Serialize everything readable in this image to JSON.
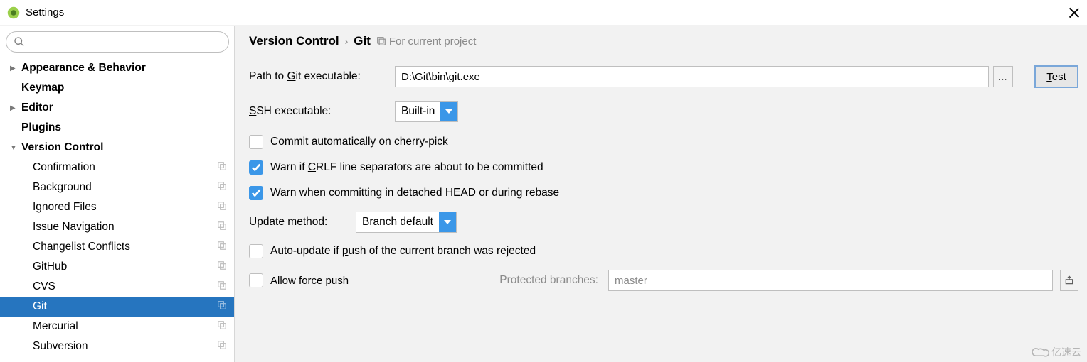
{
  "window": {
    "title": "Settings"
  },
  "sidebar": {
    "search_placeholder": "",
    "items": [
      {
        "label": "Appearance & Behavior",
        "bold": true,
        "caret": "right",
        "level": 1
      },
      {
        "label": "Keymap",
        "bold": true,
        "caret": "",
        "level": 1
      },
      {
        "label": "Editor",
        "bold": true,
        "caret": "right",
        "level": 1
      },
      {
        "label": "Plugins",
        "bold": true,
        "caret": "",
        "level": 1
      },
      {
        "label": "Version Control",
        "bold": true,
        "caret": "down",
        "level": 1
      },
      {
        "label": "Confirmation",
        "level": 2,
        "copy": true
      },
      {
        "label": "Background",
        "level": 2,
        "copy": true
      },
      {
        "label": "Ignored Files",
        "level": 2,
        "copy": true
      },
      {
        "label": "Issue Navigation",
        "level": 2,
        "copy": true
      },
      {
        "label": "Changelist Conflicts",
        "level": 2,
        "copy": true
      },
      {
        "label": "GitHub",
        "level": 2,
        "copy": true
      },
      {
        "label": "CVS",
        "level": 2,
        "copy": true
      },
      {
        "label": "Git",
        "level": 2,
        "copy": true,
        "selected": true
      },
      {
        "label": "Mercurial",
        "level": 2,
        "copy": true
      },
      {
        "label": "Subversion",
        "level": 2,
        "copy": true
      }
    ]
  },
  "breadcrumb": {
    "seg1": "Version Control",
    "seg2": "Git",
    "scope": "For current project"
  },
  "form": {
    "path_label_pre": "Path to ",
    "path_label_key": "G",
    "path_label_post": "it executable:",
    "path_value": "D:\\Git\\bin\\git.exe",
    "test_label_key": "T",
    "test_label_post": "est",
    "ssh_label_key": "S",
    "ssh_label_post": "SH executable:",
    "ssh_value": "Built-in",
    "chk_commit": "Commit automatically on cherry-pick",
    "chk_crlf_pre": "Warn if ",
    "chk_crlf_key": "C",
    "chk_crlf_post": "RLF line separators are about to be committed",
    "chk_detached": "Warn when committing in detached HEAD or during rebase",
    "update_label": "Update method:",
    "update_value": "Branch default",
    "chk_autoupdate_pre": "Auto-update if ",
    "chk_autoupdate_key": "p",
    "chk_autoupdate_post": "ush of the current branch was rejected",
    "chk_force_pre": "Allow ",
    "chk_force_key": "f",
    "chk_force_post": "orce push",
    "protected_label": "Protected branches:",
    "protected_value": "master"
  },
  "watermark": "亿速云"
}
